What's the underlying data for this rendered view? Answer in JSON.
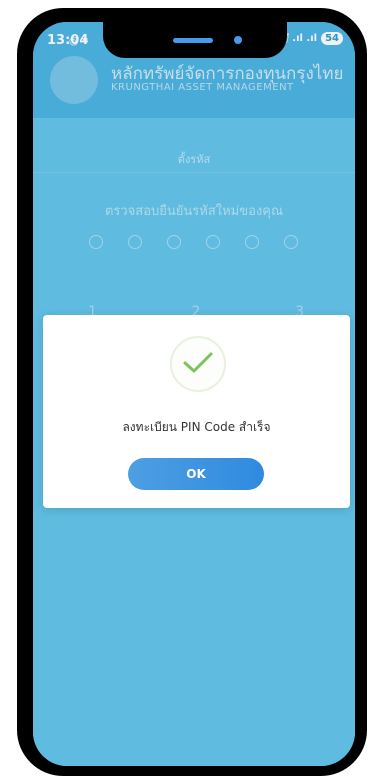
{
  "status_bar": {
    "time": "13:04",
    "left_icons": "◎ ▾",
    "signal": "ⅉ .ıl .ıl",
    "battery": "54"
  },
  "header": {
    "company_th": "หลักทรัพย์จัดการกองทุนกรุงไทย",
    "company_en": "KRUNGTHAI ASSET MANAGEMENT"
  },
  "page": {
    "title": "ตั้งรหัส",
    "subtitle": "ตรวจสอบยืนยันรหัสใหม่ของคุณ",
    "keys": [
      "1",
      "2",
      "3"
    ]
  },
  "modal": {
    "message": "ลงทะเบียน PIN Code สำเร็จ",
    "ok_label": "OK",
    "icon": "check-icon"
  },
  "colors": {
    "background": "#65c8ee",
    "header": "#4eb6e6",
    "accent": "#2f8ae0",
    "check": "#7dc35b"
  }
}
